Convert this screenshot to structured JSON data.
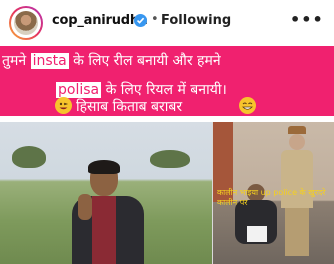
{
  "header": {
    "username": "cop_anirudha",
    "separator": "•",
    "follow_label": "Following",
    "more_label": "•••",
    "colors": {
      "verified": "#3897f0"
    },
    "icons": {
      "verified": "verified-badge-icon",
      "more": "more-options-icon"
    }
  },
  "post": {
    "banner": {
      "line1_pre": "तुमने",
      "line1_hl": "insta",
      "line1_post": "के लिए रील बनायी और हमने",
      "line2_hl": "polisa",
      "line2_post": "के लिए रियल में बनायी।",
      "line3": "हिसाब किताब बराबर",
      "colors": {
        "background": "#f0216f",
        "text": "#ffffff"
      }
    },
    "right_caption": "कालीन भाइया up police के खुरदरे कालीन पर"
  }
}
